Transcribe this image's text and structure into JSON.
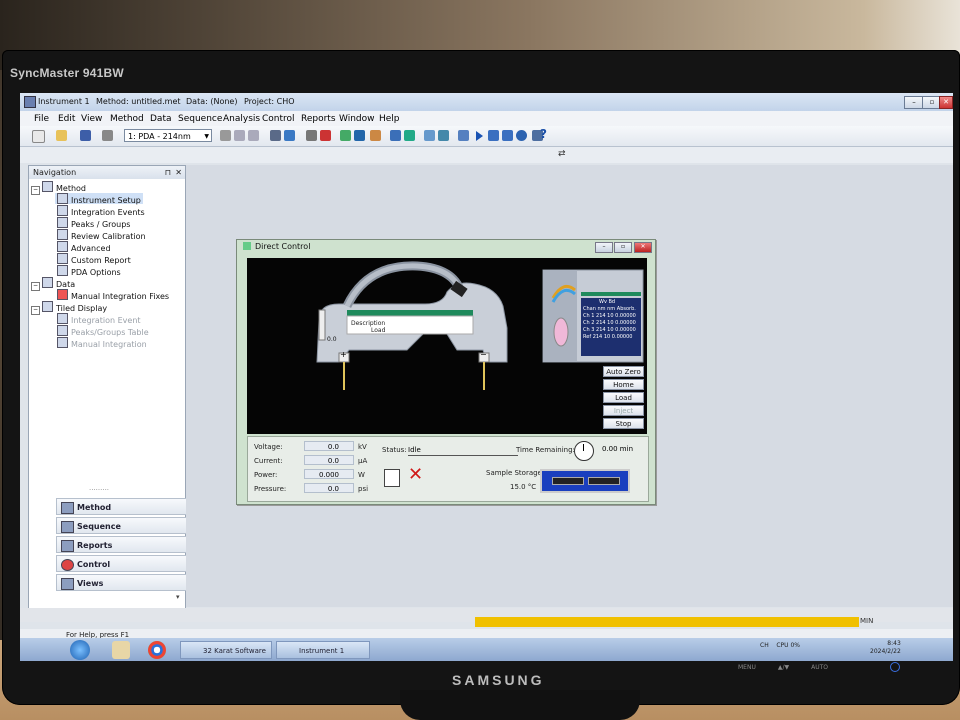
{
  "monitor": {
    "top_brand": "SyncMaster 941BW",
    "bottom_brand": "SAMSUNG",
    "buttons": [
      "MENU",
      "▲/▼",
      "AUTO"
    ]
  },
  "window": {
    "app_name": "Instrument 1",
    "method": "Method: untitled.met",
    "data": "Data: (None)",
    "project": "Project: CHO"
  },
  "menu": [
    "File",
    "Edit",
    "View",
    "Method",
    "Data",
    "Sequence",
    "Analysis",
    "Control",
    "Reports",
    "Window",
    "Help"
  ],
  "toolbar": {
    "detector_select": "1: PDA - 214nm",
    "help": "?"
  },
  "navigation": {
    "title": "Navigation",
    "pin": "⊓",
    "close": "✕",
    "tree": [
      {
        "label": "Method",
        "level": 0,
        "expander": "−"
      },
      {
        "label": "Instrument Setup",
        "level": 2,
        "selected": true
      },
      {
        "label": "Integration Events",
        "level": 2
      },
      {
        "label": "Peaks / Groups",
        "level": 2
      },
      {
        "label": "Review Calibration",
        "level": 2
      },
      {
        "label": "Advanced",
        "level": 2
      },
      {
        "label": "Custom Report",
        "level": 2
      },
      {
        "label": "PDA Options",
        "level": 2
      },
      {
        "label": "Data",
        "level": 0,
        "expander": "−"
      },
      {
        "label": "Manual Integration Fixes",
        "level": 2
      },
      {
        "label": "Tiled Display",
        "level": 0,
        "expander": "−"
      },
      {
        "label": "Integration Event",
        "level": 2,
        "dim": true
      },
      {
        "label": "Peaks/Groups Table",
        "level": 2,
        "dim": true
      },
      {
        "label": "Manual Integration",
        "level": 2,
        "dim": true
      }
    ],
    "grip": "·········",
    "buttons": [
      "Method",
      "Sequence",
      "Reports",
      "Control",
      "Views"
    ],
    "more": "▾"
  },
  "dialog": {
    "title": "Direct Control",
    "cartridge": {
      "description": "Description",
      "state": "Load",
      "temp": "0.0"
    },
    "detector_table": {
      "header1": [
        "Wv",
        "Bd"
      ],
      "header2": [
        "Chan",
        "nm",
        "nm",
        "Absorb."
      ],
      "rows": [
        [
          "Ch 1",
          "214",
          "10",
          "0.00000"
        ],
        [
          "Ch 2",
          "214",
          "10",
          "0.00000"
        ],
        [
          "Ch 3",
          "214",
          "10",
          "0.00000"
        ],
        [
          "Ref",
          "214",
          "10",
          "0.00000"
        ]
      ]
    },
    "buttons": [
      {
        "label": "Auto Zero",
        "enabled": true
      },
      {
        "label": "Home",
        "enabled": true
      },
      {
        "label": "Load",
        "enabled": true
      },
      {
        "label": "Inject",
        "enabled": false
      },
      {
        "label": "Stop",
        "enabled": true
      }
    ],
    "readings": [
      {
        "label": "Voltage:",
        "value": "0.0",
        "unit": "kV"
      },
      {
        "label": "Current:",
        "value": "0.0",
        "unit": "µA"
      },
      {
        "label": "Power:",
        "value": "0.000",
        "unit": "W"
      },
      {
        "label": "Pressure:",
        "value": "0.0",
        "unit": "psi"
      }
    ],
    "status_label": "Status:",
    "status": "Idle",
    "time_remaining_label": "Time Remaining:",
    "time_remaining": "0.00 min",
    "sample_storage_label": "Sample Storage:",
    "sample_storage_temp": "15.0 °C"
  },
  "statusbar": {
    "help": "For Help, press F1",
    "min_label": "MIN"
  },
  "taskbar": {
    "buttons": [
      "32 Karat Software",
      "Instrument 1"
    ],
    "tray": "CH",
    "tray2": "CPU 0%",
    "time": "8:43",
    "date": "2024/2/22"
  },
  "colors": {
    "accent_green": "#1f8a5c",
    "progress": "#f0c000",
    "storage_blue": "#1a3fbf"
  }
}
